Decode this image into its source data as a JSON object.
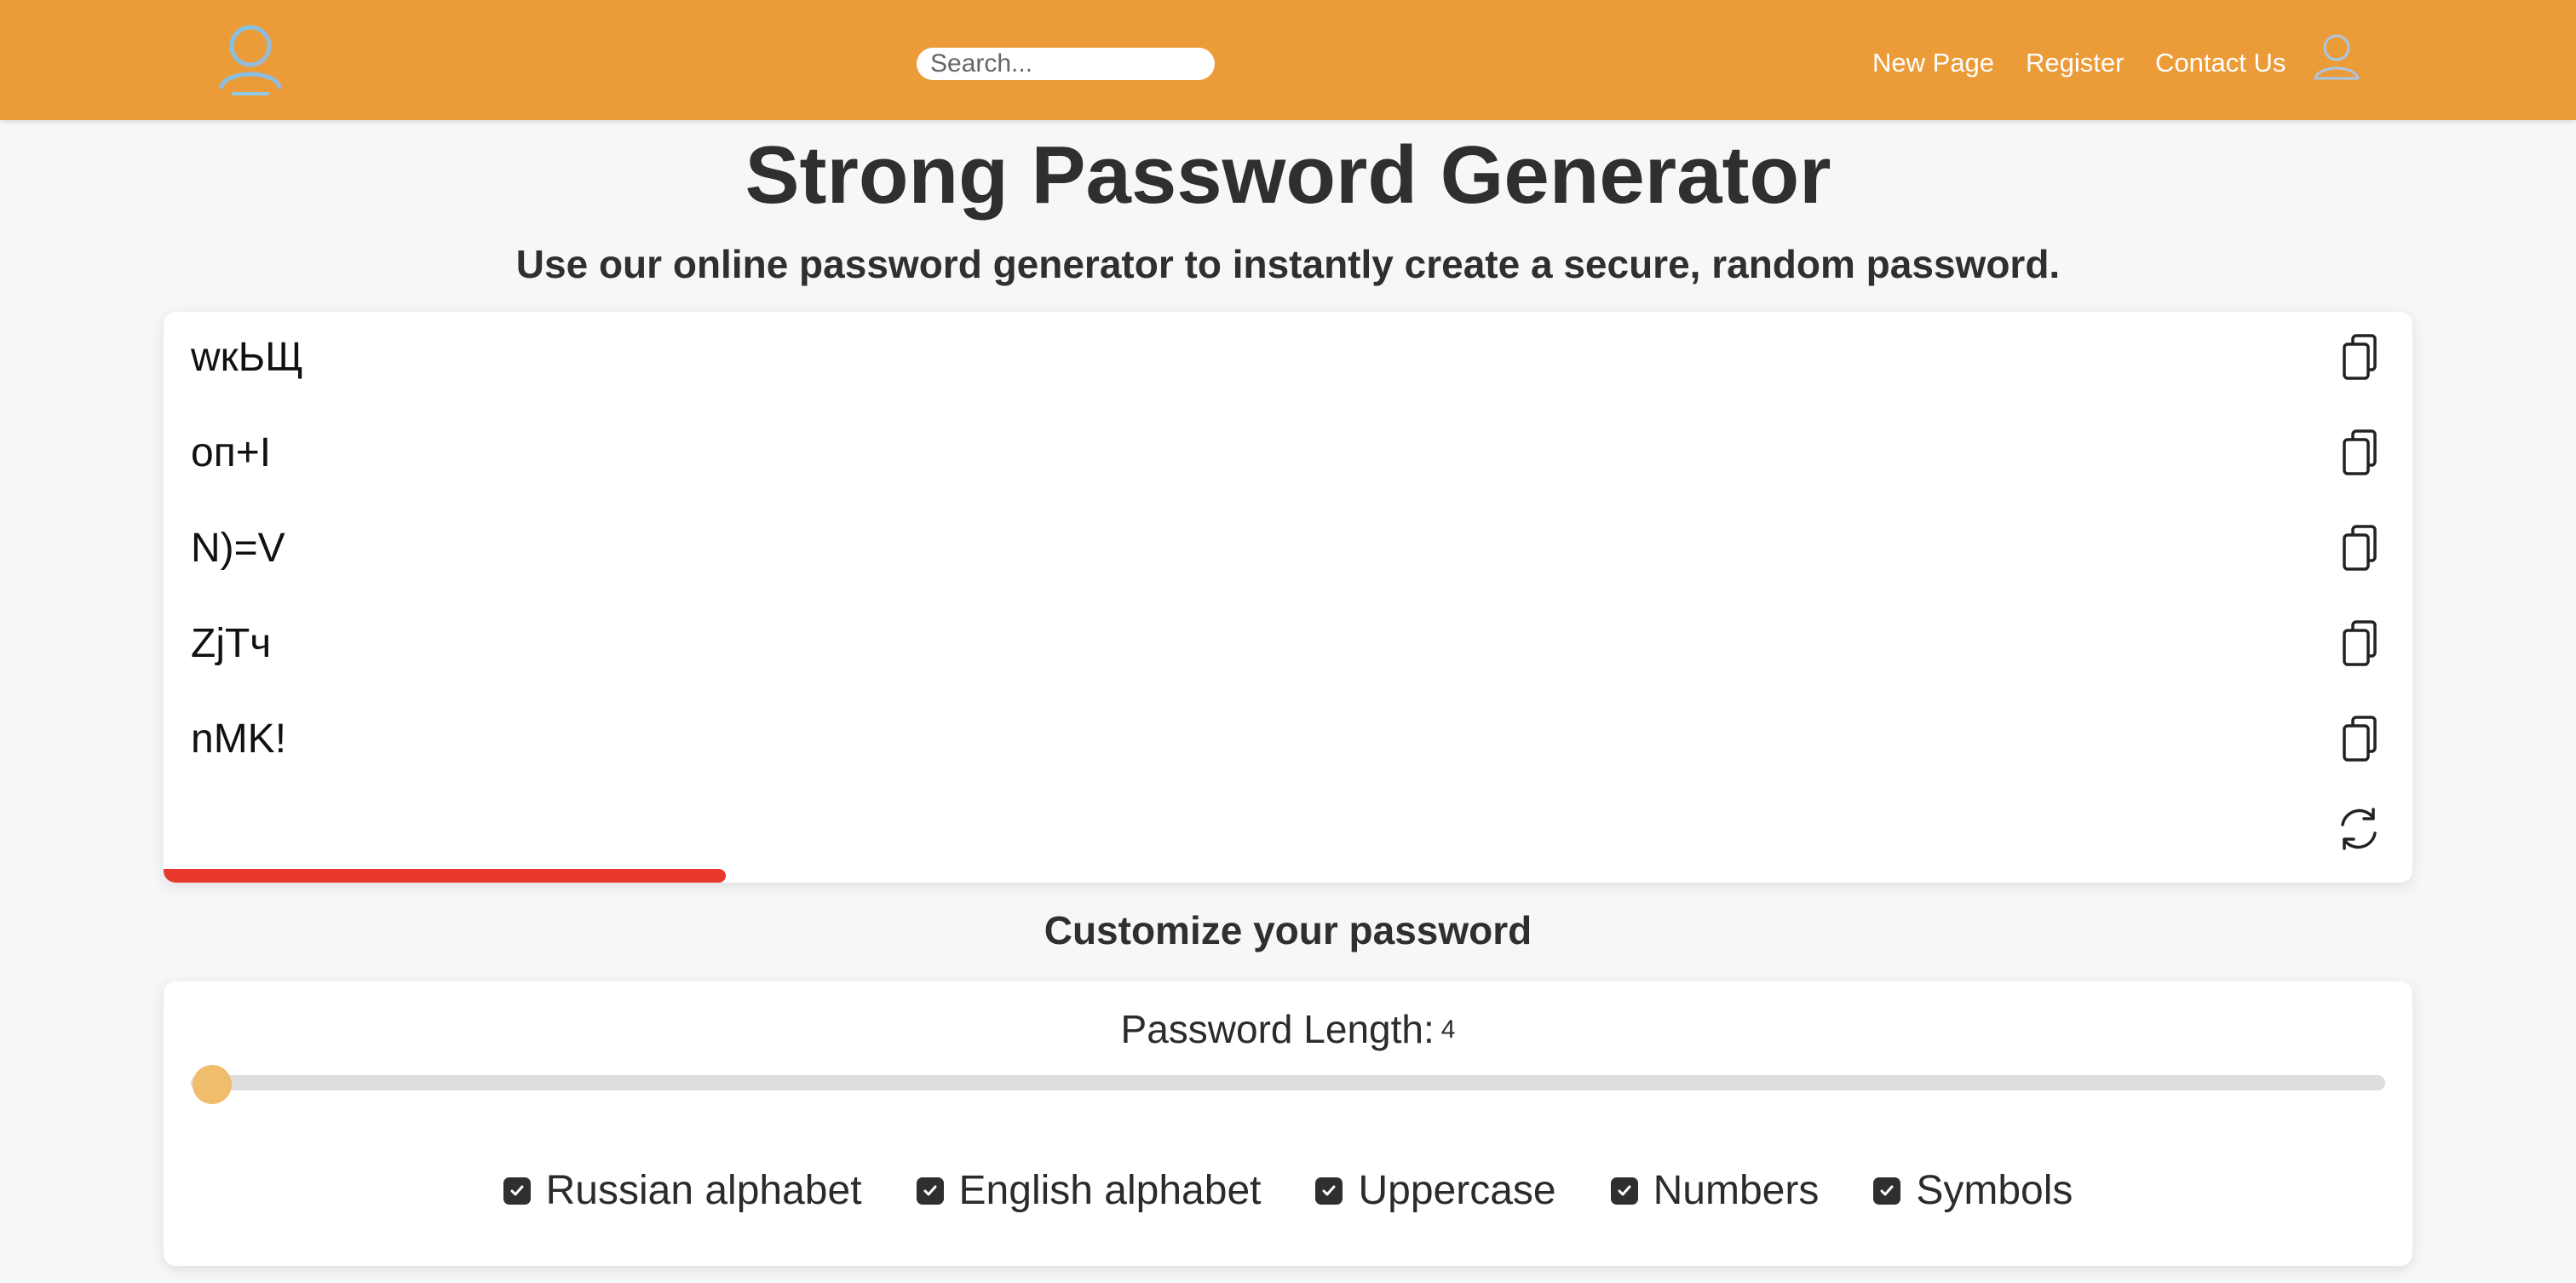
{
  "header": {
    "search_placeholder": "Search...",
    "nav": [
      {
        "label": "New Page"
      },
      {
        "label": "Register"
      },
      {
        "label": "Contact Us"
      }
    ],
    "accent": "#eb9c38"
  },
  "main": {
    "title": "Strong Password Generator",
    "subtitle": "Use our online password generator to instantly create a secure, random password."
  },
  "passwords": [
    {
      "value": "wкЬЩ"
    },
    {
      "value": "оп+I"
    },
    {
      "value": "N)=V"
    },
    {
      "value": "ZjTч"
    },
    {
      "value": "nMK!"
    }
  ],
  "strength": {
    "level": 0.25,
    "color": "#e8372b"
  },
  "customize": {
    "section_title": "Customize your password",
    "length_label": "Password Length:",
    "length_value": "4",
    "length_min": 4,
    "length_max": 50,
    "options": [
      {
        "label": "Russian alphabet",
        "checked": true
      },
      {
        "label": "English alphabet",
        "checked": true
      },
      {
        "label": "Uppercase",
        "checked": true
      },
      {
        "label": "Numbers",
        "checked": true
      },
      {
        "label": "Symbols",
        "checked": true
      }
    ]
  }
}
